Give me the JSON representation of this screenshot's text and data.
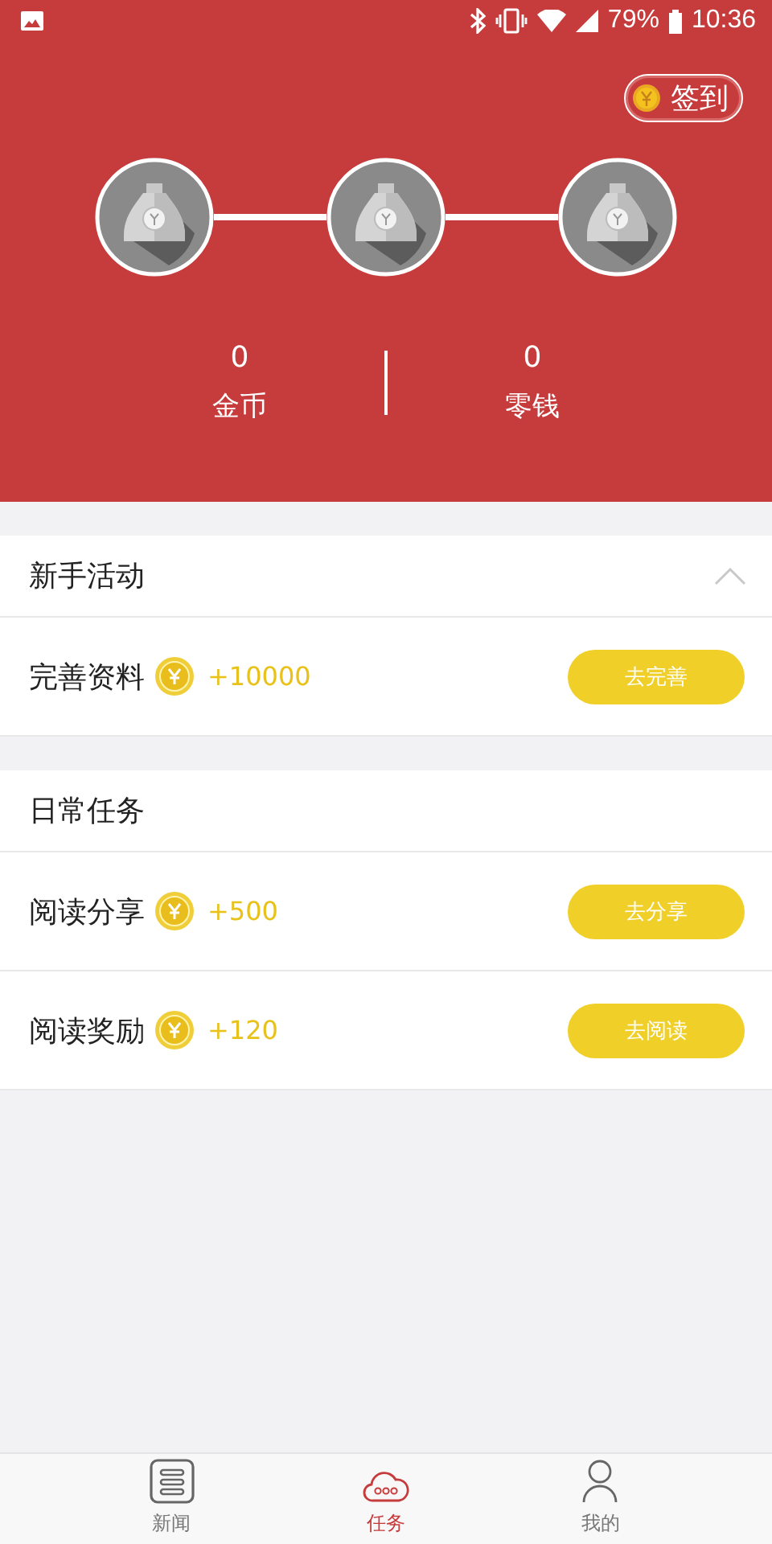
{
  "status_bar": {
    "battery": "79%",
    "time": "10:36"
  },
  "header": {
    "sign_in": "签到",
    "stats": [
      {
        "value": "0",
        "label": "金币"
      },
      {
        "value": "0",
        "label": "零钱"
      }
    ]
  },
  "sections": [
    {
      "title": "新手活动",
      "expanded": true,
      "tasks": [
        {
          "name": "完善资料",
          "reward": "+10000",
          "action": "去完善"
        }
      ]
    },
    {
      "title": "日常任务",
      "tasks": [
        {
          "name": "阅读分享",
          "reward": "+500",
          "action": "去分享"
        },
        {
          "name": "阅读奖励",
          "reward": "+120",
          "action": "去阅读"
        }
      ]
    }
  ],
  "tabs": [
    {
      "label": "新闻",
      "kind": "news",
      "selected": false
    },
    {
      "label": "任务",
      "kind": "tasks",
      "selected": true
    },
    {
      "label": "我的",
      "kind": "profile",
      "selected": false
    }
  ]
}
